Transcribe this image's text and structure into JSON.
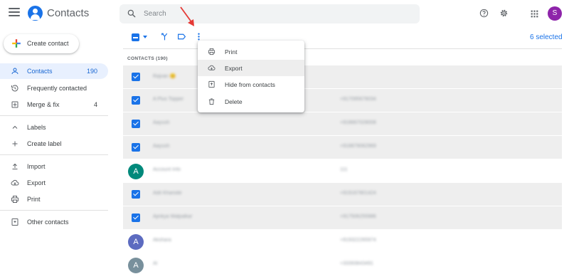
{
  "app": {
    "title": "Contacts"
  },
  "search": {
    "placeholder": "Search"
  },
  "user": {
    "initial": "S",
    "avatar_color": "#8e24aa"
  },
  "sidebar": {
    "create_label": "Create contact",
    "items": [
      {
        "label": "Contacts",
        "count": "190",
        "icon": "person-icon",
        "active": true
      },
      {
        "label": "Frequently contacted",
        "count": "",
        "icon": "history-icon"
      },
      {
        "label": "Merge & fix",
        "count": "4",
        "icon": "merge-icon"
      },
      {
        "label": "Labels",
        "count": "",
        "icon": "chevron-up-icon"
      },
      {
        "label": "Create label",
        "count": "",
        "icon": "plus-icon"
      },
      {
        "label": "Import",
        "count": "",
        "icon": "upload-icon"
      },
      {
        "label": "Export",
        "count": "",
        "icon": "cloud-download-icon"
      },
      {
        "label": "Print",
        "count": "",
        "icon": "print-icon"
      },
      {
        "label": "Other contacts",
        "count": "",
        "icon": "contact-box-icon"
      }
    ]
  },
  "toolbar": {
    "selected_text": "6 selected"
  },
  "list": {
    "title": "CONTACTS (190)",
    "rows": [
      {
        "selected": true,
        "name": "Rajvan 😊",
        "phone": "",
        "initial": "",
        "avatar_color": ""
      },
      {
        "selected": true,
        "name": "A Plus Topper",
        "phone": "+917095676034",
        "initial": "",
        "avatar_color": ""
      },
      {
        "selected": true,
        "name": "Aayush",
        "phone": "+918667028008",
        "initial": "",
        "avatar_color": ""
      },
      {
        "selected": true,
        "name": "Aayush",
        "phone": "+918879062969",
        "initial": "",
        "avatar_color": ""
      },
      {
        "selected": false,
        "name": "Account Info",
        "phone": "111",
        "initial": "A",
        "avatar_color": "#00897b"
      },
      {
        "selected": true,
        "name": "Adit Kharode",
        "phone": "+919167801424",
        "initial": "",
        "avatar_color": ""
      },
      {
        "selected": true,
        "name": "Ajinkya Walpalkar",
        "phone": "+917506255986",
        "initial": "",
        "avatar_color": ""
      },
      {
        "selected": false,
        "name": "Akshara",
        "phone": "+919322265974",
        "initial": "A",
        "avatar_color": "#5c6bc0"
      },
      {
        "selected": false,
        "name": "Al",
        "phone": "+33393843491",
        "initial": "A",
        "avatar_color": "#78909c"
      }
    ]
  },
  "menu": {
    "items": [
      {
        "label": "Print",
        "icon": "print-icon"
      },
      {
        "label": "Export",
        "icon": "cloud-download-icon",
        "hover": true
      },
      {
        "label": "Hide from contacts",
        "icon": "hide-contact-icon"
      },
      {
        "label": "Delete",
        "icon": "trash-icon"
      }
    ]
  },
  "colors": {
    "accent": "#1a73e8",
    "annotation_arrow": "#e53935"
  }
}
